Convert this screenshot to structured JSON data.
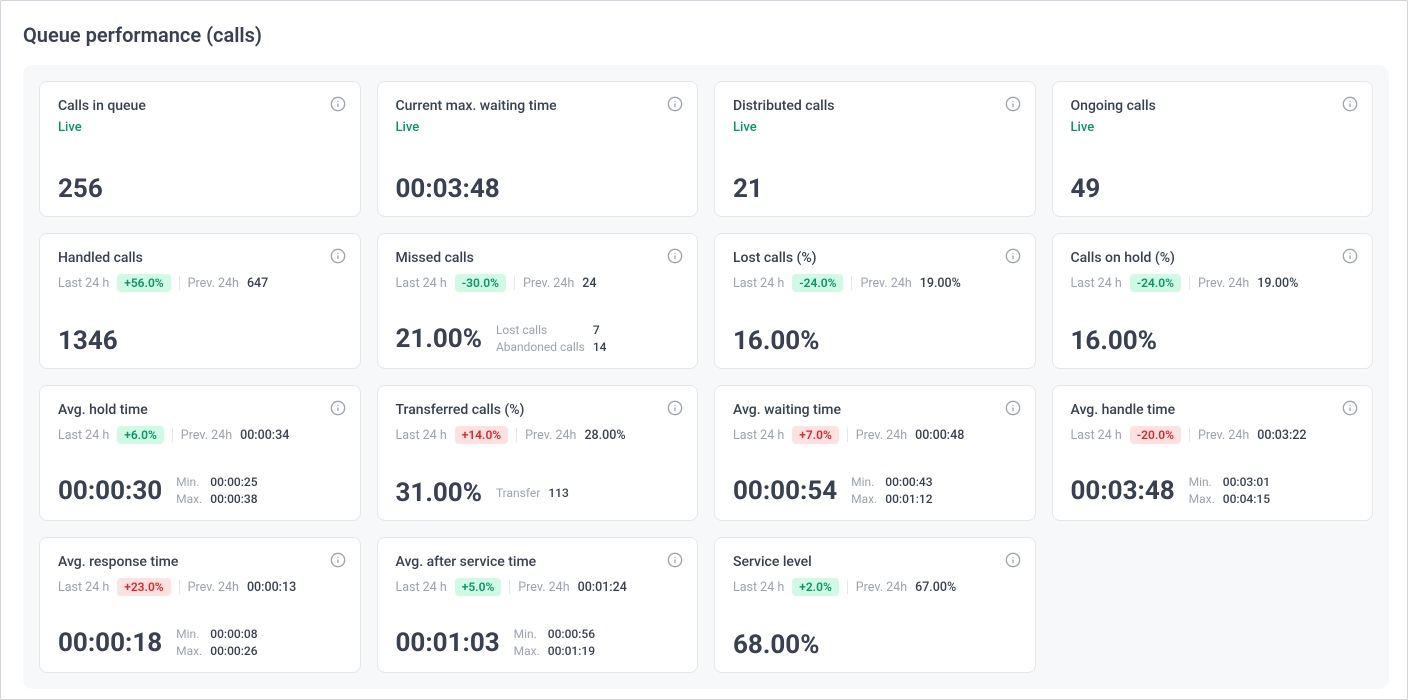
{
  "title": "Queue performance (calls)",
  "labels": {
    "live": "Live",
    "last24": "Last 24 h",
    "prev24": "Prev. 24h",
    "min": "Min.",
    "max": "Max."
  },
  "cards": [
    {
      "id": "calls-in-queue",
      "type": "live",
      "title": "Calls in queue",
      "value": "256"
    },
    {
      "id": "current-max-waiting-time",
      "type": "live",
      "title": "Current max. waiting time",
      "value": "00:03:48"
    },
    {
      "id": "distributed-calls",
      "type": "live",
      "title": "Distributed calls",
      "value": "21"
    },
    {
      "id": "ongoing-calls",
      "type": "live",
      "title": "Ongoing calls",
      "value": "49"
    },
    {
      "id": "handled-calls",
      "type": "metric",
      "title": "Handled calls",
      "delta": "+56.0%",
      "delta_color": "green",
      "prev": "647",
      "value": "1346"
    },
    {
      "id": "missed-calls",
      "type": "metric",
      "title": "Missed calls",
      "delta": "-30.0%",
      "delta_color": "green",
      "prev": "24",
      "value": "21.00%",
      "extra": [
        {
          "label": "Lost calls",
          "value": "7"
        },
        {
          "label": "Abandoned calls",
          "value": "14"
        }
      ]
    },
    {
      "id": "lost-calls-pct",
      "type": "metric",
      "title": "Lost calls (%)",
      "delta": "-24.0%",
      "delta_color": "green",
      "prev": "19.00%",
      "value": "16.00%"
    },
    {
      "id": "calls-on-hold-pct",
      "type": "metric",
      "title": "Calls on hold (%)",
      "delta": "-24.0%",
      "delta_color": "green",
      "prev": "19.00%",
      "value": "16.00%"
    },
    {
      "id": "avg-hold-time",
      "type": "metric",
      "title": "Avg. hold time",
      "delta": "+6.0%",
      "delta_color": "green",
      "prev": "00:00:34",
      "value": "00:00:30",
      "minmax": {
        "min": "00:00:25",
        "max": "00:00:38"
      }
    },
    {
      "id": "transferred-calls-pct",
      "type": "metric",
      "title": "Transferred calls (%)",
      "delta": "+14.0%",
      "delta_color": "red",
      "prev": "28.00%",
      "value": "31.00%",
      "extra": [
        {
          "label": "Transfer",
          "value": "113"
        }
      ]
    },
    {
      "id": "avg-waiting-time",
      "type": "metric",
      "title": "Avg. waiting time",
      "delta": "+7.0%",
      "delta_color": "red",
      "prev": "00:00:48",
      "value": "00:00:54",
      "minmax": {
        "min": "00:00:43",
        "max": "00:01:12"
      }
    },
    {
      "id": "avg-handle-time",
      "type": "metric",
      "title": "Avg. handle time",
      "delta": "-20.0%",
      "delta_color": "red",
      "prev": "00:03:22",
      "value": "00:03:48",
      "minmax": {
        "min": "00:03:01",
        "max": "00:04:15"
      }
    },
    {
      "id": "avg-response-time",
      "type": "metric",
      "title": "Avg. response time",
      "delta": "+23.0%",
      "delta_color": "red",
      "prev": "00:00:13",
      "value": "00:00:18",
      "minmax": {
        "min": "00:00:08",
        "max": "00:00:26"
      }
    },
    {
      "id": "avg-after-service-time",
      "type": "metric",
      "title": "Avg. after service time",
      "delta": "+5.0%",
      "delta_color": "green",
      "prev": "00:01:24",
      "value": "00:01:03",
      "minmax": {
        "min": "00:00:56",
        "max": "00:01:19"
      }
    },
    {
      "id": "service-level",
      "type": "metric",
      "title": "Service level",
      "delta": "+2.0%",
      "delta_color": "green",
      "prev": "67.00%",
      "value": "68.00%"
    }
  ]
}
